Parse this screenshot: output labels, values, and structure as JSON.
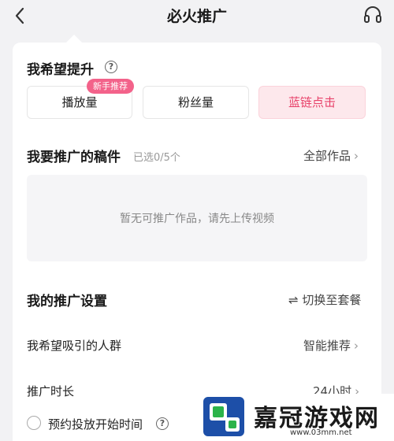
{
  "header": {
    "title": "必火推广"
  },
  "goal": {
    "title": "我希望提升",
    "badge": "新手推荐",
    "options": [
      {
        "label": "播放量",
        "selected": false
      },
      {
        "label": "粉丝量",
        "selected": false
      },
      {
        "label": "蓝链点击",
        "selected": true
      }
    ]
  },
  "works": {
    "title": "我要推广的稿件",
    "hint": "已选0/5个",
    "all_link": "全部作品",
    "empty_text": "暂无可推广作品，请先上传视频"
  },
  "settings": {
    "title": "我的推广设置",
    "switch_link": "⇌ 切换至套餐",
    "audience_label": "我希望吸引的人群",
    "audience_value": "智能推荐",
    "duration_label": "推广时长",
    "duration_value": "24小时",
    "schedule_label": "预约投放开始时间"
  },
  "watermark": {
    "name": "嘉冠游戏网",
    "url": "www.03mm.net"
  },
  "colors": {
    "accent": "#e8426a",
    "badge": "#f3628a",
    "selected_bg": "#fde8ec"
  }
}
